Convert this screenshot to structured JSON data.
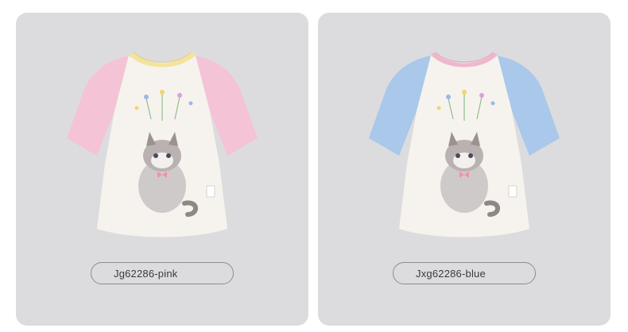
{
  "products": [
    {
      "label": "Jg62286-pink",
      "sleeve_color": "#f4c3d6",
      "collar_color": "#f4e49a",
      "collar_inner": "#f7eaa8",
      "body_color": "#f6f3ee"
    },
    {
      "label": "Jxg62286-blue",
      "sleeve_color": "#a9c8ea",
      "collar_color": "#f0b6cc",
      "collar_inner": "#f5c7d8",
      "body_color": "#f6f3ee"
    }
  ]
}
